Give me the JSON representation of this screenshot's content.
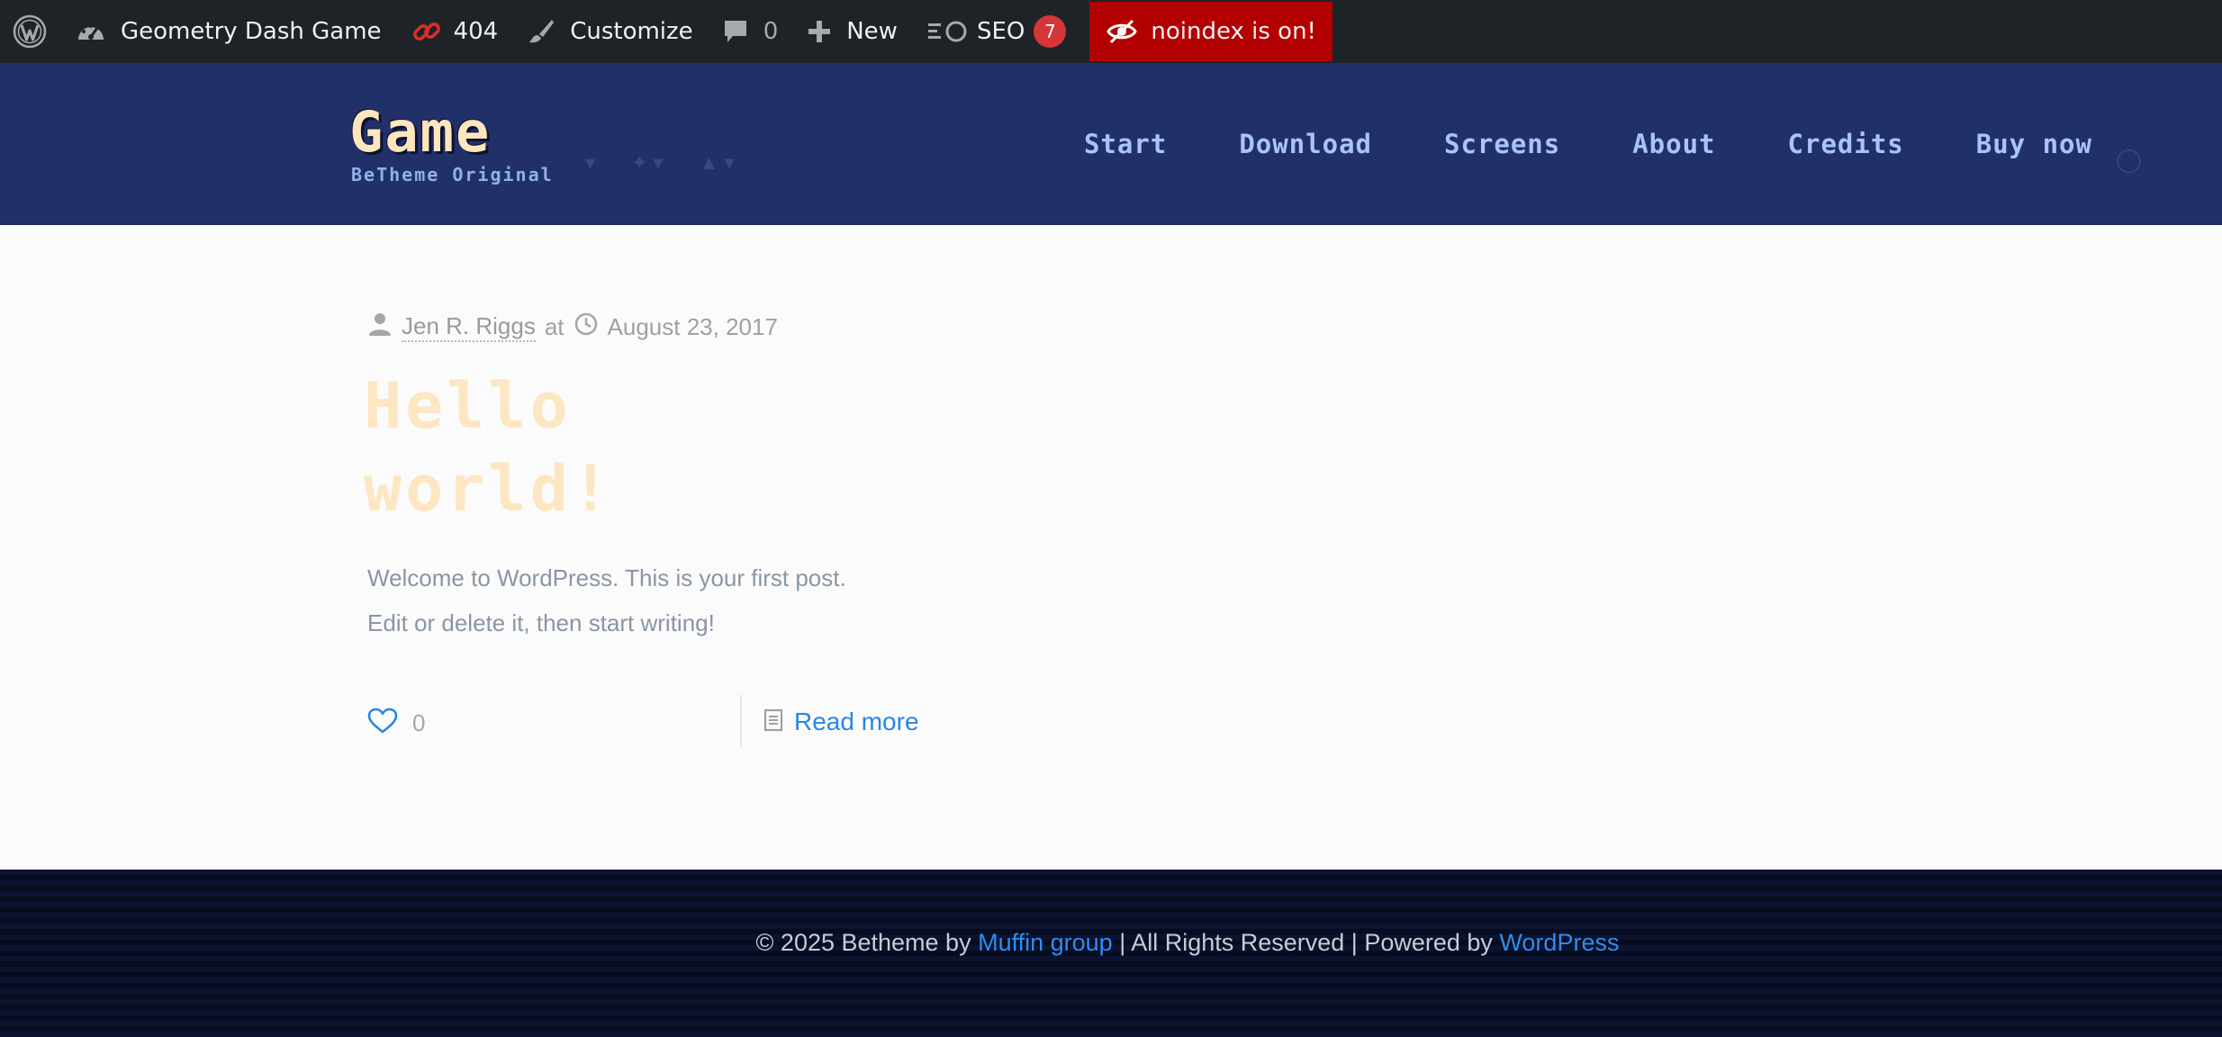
{
  "admin_bar": {
    "site_name": "Geometry Dash Game",
    "redirect_count": "404",
    "customize": "Customize",
    "comments_count": "0",
    "new_label": "New",
    "seo_label": "SEO",
    "seo_badge": "7",
    "noindex_label": "noindex is on!",
    "icons": [
      "wordpress-logo-icon",
      "dashboard-icon",
      "broken-link-icon",
      "paintbrush-icon",
      "comment-icon",
      "plus-icon",
      "seo-icon",
      "eye-slash-icon"
    ],
    "colors": {
      "bar": "#1d2327",
      "noindex": "#b30000",
      "badge": "#d63638"
    }
  },
  "header": {
    "logo_text": "Game",
    "tagline": "BeTheme Original",
    "nav": [
      "Start",
      "Download",
      "Screens",
      "About",
      "Credits",
      "Buy now"
    ],
    "colors": {
      "background": "#22306a",
      "nav": "#a9c4f7",
      "logo": "#fde6be"
    }
  },
  "post": {
    "author": "Jen R. Riggs",
    "at": "at",
    "date": "August 23, 2017",
    "title_line1": "Hello",
    "title_line2": "world!",
    "excerpt_line1": "Welcome to WordPress. This is your first post.",
    "excerpt_line2": "Edit or delete it, then start writing!",
    "likes": "0",
    "read_more": "Read more",
    "colors": {
      "title": "#fde6c2",
      "link": "#2a86e2"
    }
  },
  "footer": {
    "copyright_prefix": "© 2025 Betheme by ",
    "muffin_link": "Muffin group",
    "middle": " | All Rights Reserved | Powered by ",
    "wordpress_link": "WordPress",
    "colors": {
      "link": "#2f8cf0",
      "text": "#c7ccd8"
    }
  }
}
